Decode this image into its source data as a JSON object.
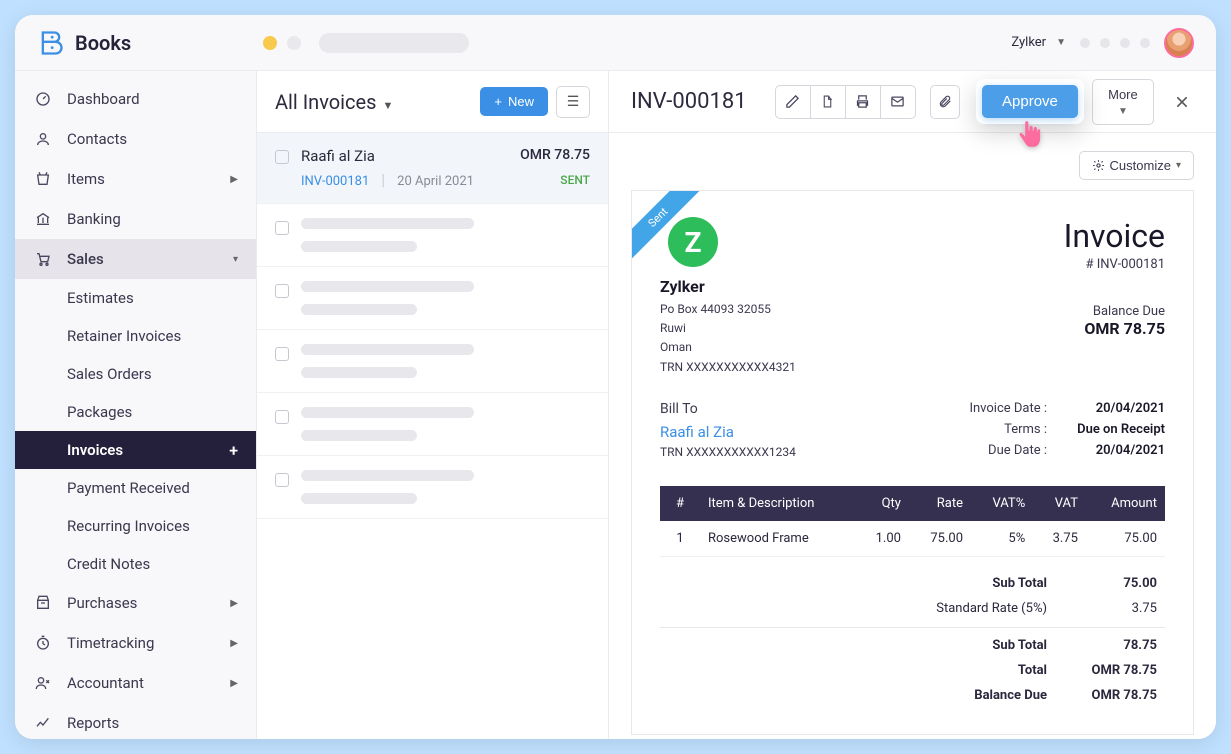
{
  "app": {
    "name": "Books",
    "org": "Zylker"
  },
  "sidebar": {
    "items": [
      {
        "label": "Dashboard"
      },
      {
        "label": "Contacts"
      },
      {
        "label": "Items"
      },
      {
        "label": "Banking"
      },
      {
        "label": "Sales"
      },
      {
        "label": "Purchases"
      },
      {
        "label": "Timetracking"
      },
      {
        "label": "Accountant"
      },
      {
        "label": "Reports"
      }
    ],
    "sales_sub": [
      {
        "label": "Estimates"
      },
      {
        "label": "Retainer Invoices"
      },
      {
        "label": "Sales Orders"
      },
      {
        "label": "Packages"
      },
      {
        "label": "Invoices"
      },
      {
        "label": "Payment Received"
      },
      {
        "label": "Recurring Invoices"
      },
      {
        "label": "Credit Notes"
      }
    ]
  },
  "list": {
    "title": "All Invoices",
    "new_label": "New",
    "rows": [
      {
        "customer": "Raafi al Zia",
        "amount": "OMR 78.75",
        "inv": "INV-000181",
        "date": "20 April 2021",
        "status": "SENT"
      }
    ]
  },
  "detail": {
    "title": "INV-000181",
    "approve": "Approve",
    "more": "More",
    "customize": "Customize",
    "ribbon": "Sent",
    "company": {
      "logo_letter": "Z",
      "name": "Zylker",
      "addr1": "Po Box 44093 32055",
      "addr2": "Ruwi",
      "addr3": "Oman",
      "trn": "TRN XXXXXXXXXXX4321"
    },
    "invoice_label": "Invoice",
    "invoice_num": "# INV-000181",
    "balance_due_label": "Balance Due",
    "balance_due": "OMR 78.75",
    "bill_to_label": "Bill To",
    "bill_to_name": "Raafi al Zia",
    "bill_to_trn": "TRN XXXXXXXXXXX1234",
    "meta": [
      {
        "label": "Invoice Date :",
        "value": "20/04/2021"
      },
      {
        "label": "Terms :",
        "value": "Due on Receipt"
      },
      {
        "label": "Due Date :",
        "value": "20/04/2021"
      }
    ],
    "columns": {
      "num": "#",
      "item": "Item & Description",
      "qty": "Qty",
      "rate": "Rate",
      "vatp": "VAT%",
      "vat": "VAT",
      "amount": "Amount"
    },
    "lines": [
      {
        "num": "1",
        "item": "Rosewood Frame",
        "qty": "1.00",
        "rate": "75.00",
        "vatp": "5%",
        "vat": "3.75",
        "amount": "75.00"
      }
    ],
    "totals": [
      {
        "label": "Sub Total",
        "value": "75.00",
        "bold": true
      },
      {
        "label": "Standard Rate (5%)",
        "value": "3.75"
      },
      {
        "label": "Sub Total",
        "value": "78.75",
        "bold": true,
        "hr": true
      },
      {
        "label": "Total",
        "value": "OMR 78.75",
        "bold": true
      },
      {
        "label": "Balance Due",
        "value": "OMR 78.75",
        "bold": true
      }
    ]
  }
}
